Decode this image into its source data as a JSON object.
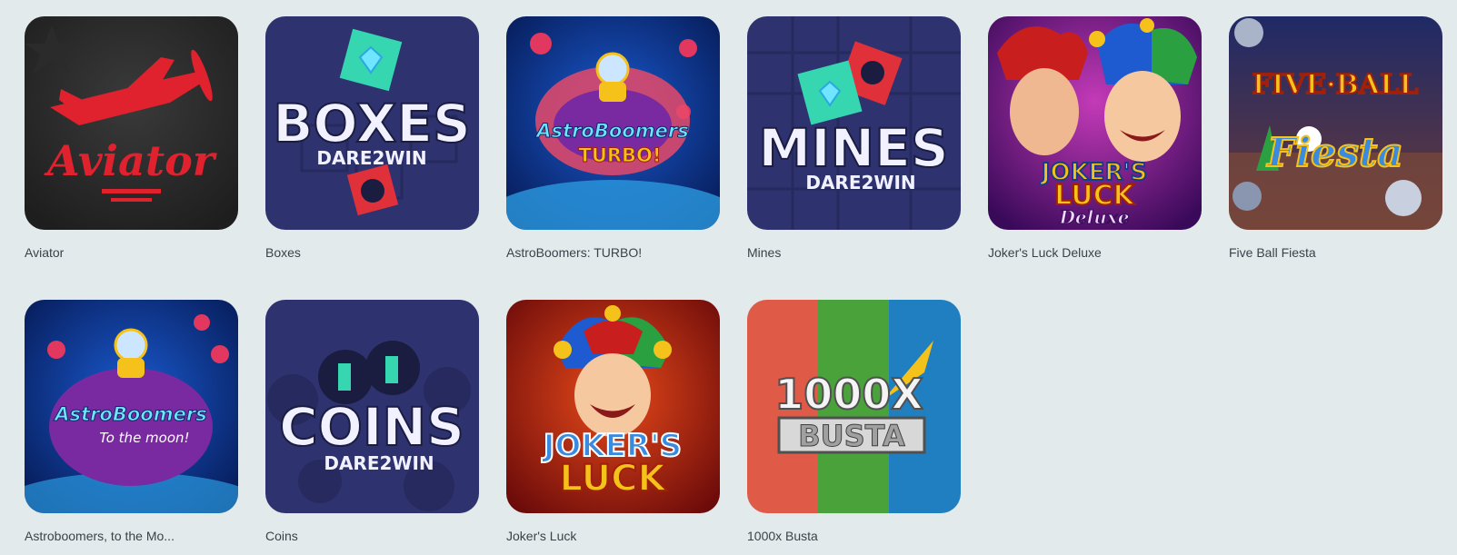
{
  "games": [
    {
      "title": "Aviator",
      "art_text": "Aviator",
      "icon": "plane-icon",
      "colors": {
        "bg": "#2e2e2e",
        "accent": "#e0212e"
      }
    },
    {
      "title": "Boxes",
      "art_text": "BOXES",
      "art_sub": "DARE2WIN",
      "icon": "diamond-icon",
      "colors": {
        "bg": "#2e3370",
        "accent": "#35d6b0"
      }
    },
    {
      "title": "AstroBoomers: TURBO!",
      "art_text": "AstroBoomers",
      "art_sub": "TURBO!",
      "icon": "astronaut-icon",
      "colors": {
        "bg": "#0b2a7a",
        "accent": "#e2385f"
      }
    },
    {
      "title": "Mines",
      "art_text": "MINES",
      "art_sub": "DARE2WIN",
      "icon": "diamond-icon",
      "colors": {
        "bg": "#2e3370",
        "accent": "#35d6b0"
      }
    },
    {
      "title": "Joker's Luck Deluxe",
      "art_text": "JOKER'S",
      "art_sub": "LUCK",
      "art_sub2": "Deluxe",
      "icon": "joker-icon",
      "colors": {
        "bg": "#5a1a7a",
        "accent": "#f5c21b"
      }
    },
    {
      "title": "Five Ball Fiesta",
      "art_text": "FIVE·BALL",
      "art_sub": "Fiesta",
      "icon": "ball-icon",
      "colors": {
        "bg": "#1f2a66",
        "accent": "#e83b2c"
      }
    },
    {
      "title": "Astroboomers, to the Mo...",
      "art_text": "AstroBoomers",
      "art_sub": "To the moon!",
      "icon": "astronaut-icon",
      "colors": {
        "bg": "#0b2a7a",
        "accent": "#e2385f"
      }
    },
    {
      "title": "Coins",
      "art_text": "COINS",
      "art_sub": "DARE2WIN",
      "icon": "coin-icon",
      "colors": {
        "bg": "#2e3370",
        "accent": "#35d6b0"
      }
    },
    {
      "title": "Joker's Luck",
      "art_text": "JOKER'S",
      "art_sub": "LUCK",
      "icon": "joker-icon",
      "colors": {
        "bg": "#8c1414",
        "accent": "#f5c21b"
      }
    },
    {
      "title": "1000x Busta",
      "art_text": "1000X",
      "art_sub": "BUSTA",
      "icon": "busta-logo",
      "colors": {
        "bg": "#4aa33a",
        "accent": "#1f7fc0"
      }
    }
  ]
}
